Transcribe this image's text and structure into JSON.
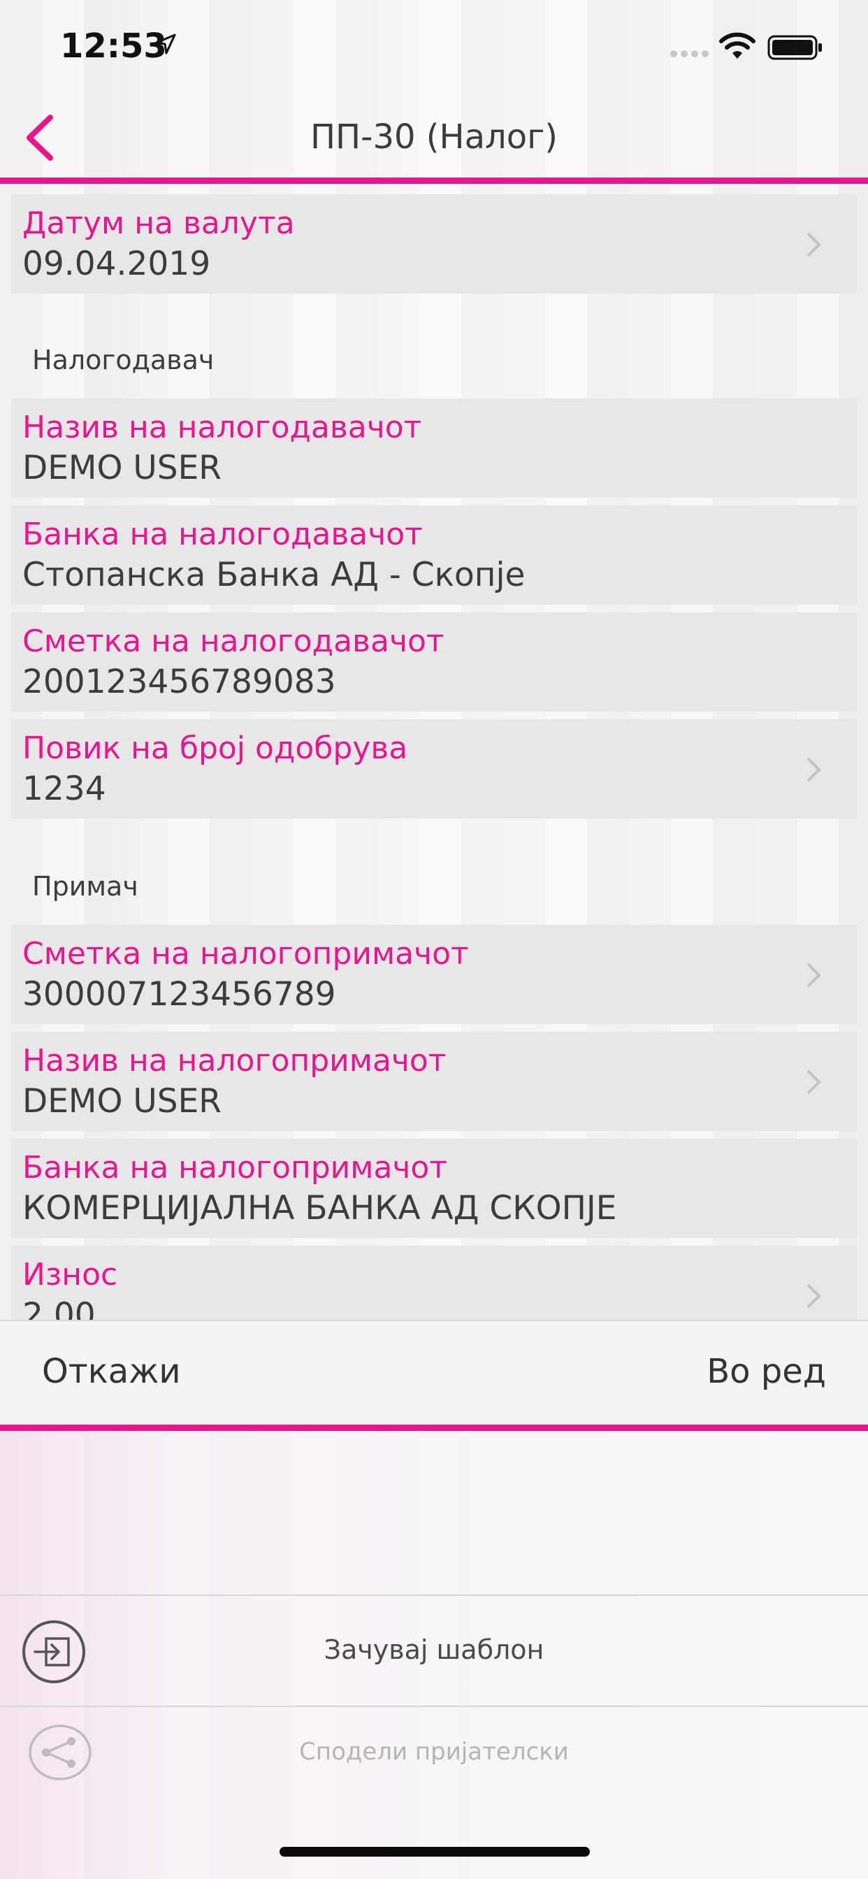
{
  "status_bar": {
    "time": "12:53"
  },
  "nav": {
    "title": "ПП-30 (Налог)"
  },
  "colors": {
    "accent": "#e8158d",
    "row_bg": "#e7e7e7"
  },
  "date_row": {
    "label": "Датум на валута",
    "value": "09.04.2019"
  },
  "sections": {
    "payer": {
      "title": "Налогодавач",
      "rows": [
        {
          "label": "Назив на налогодавачот",
          "value": "DEMO USER"
        },
        {
          "label": "Банка на налогодавачот",
          "value": "Стопанска Банка АД - Скопје"
        },
        {
          "label": "Сметка на налогодавачот",
          "value": "200123456789083"
        },
        {
          "label": "Повик на број одобрува",
          "value": "1234"
        }
      ]
    },
    "recipient": {
      "title": "Примач",
      "rows": [
        {
          "label": "Сметка на налогопримачот",
          "value": "300007123456789"
        },
        {
          "label": "Назив на налогопримачот",
          "value": "DEMO USER"
        },
        {
          "label": "Банка на налогопримачот",
          "value": "КОМЕРЦИЈАЛНА БАНКА АД СКОПЈЕ"
        },
        {
          "label": "Износ",
          "value": "2.00"
        }
      ]
    }
  },
  "actions": {
    "cancel": "Откажи",
    "ok": "Во ред"
  },
  "menu": {
    "save_template": "Зачувај шаблон",
    "share": "Сподели пријателски"
  },
  "icons": [
    "location-arrow-icon",
    "signal-icon",
    "wifi-icon",
    "battery-icon",
    "back-chevron-icon",
    "chevron-right-icon",
    "save-template-icon",
    "share-icon"
  ]
}
